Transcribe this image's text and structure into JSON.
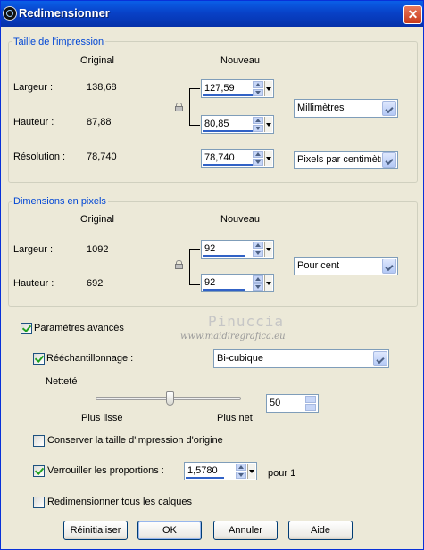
{
  "window": {
    "title": "Redimensionner",
    "close_glyph": "✕",
    "icon": "app-icon"
  },
  "print_size": {
    "legend": "Taille de l'impression",
    "col_original": "Original",
    "col_new": "Nouveau",
    "width_label": "Largeur :",
    "width_original": "138,68",
    "width_new": "127,59",
    "height_label": "Hauteur :",
    "height_original": "87,88",
    "height_new": "80,85",
    "resolution_label": "Résolution :",
    "resolution_original": "78,740",
    "resolution_new": "78,740",
    "unit_select": "Millimètres",
    "resolution_unit_select": "Pixels par centimètre"
  },
  "pixel_dims": {
    "legend": "Dimensions en pixels",
    "col_original": "Original",
    "col_new": "Nouveau",
    "width_label": "Largeur :",
    "width_original": "1092",
    "width_new": "92",
    "height_label": "Hauteur :",
    "height_original": "692",
    "height_new": "92",
    "unit_select": "Pour cent"
  },
  "watermark": {
    "line1": "Pinuccia",
    "line2": "www.maidiregrafica.eu"
  },
  "advanced": {
    "checkbox_label": "Paramètres avancés",
    "checked": true,
    "resample_label": "Rééchantillonnage :",
    "resample_checked": true,
    "resample_method": "Bi-cubique",
    "sharpness_label": "Netteté",
    "slider_left_label": "Plus lisse",
    "slider_right_label": "Plus net",
    "sharpness_value": "50",
    "sharpness_fraction": 0.5,
    "keep_print_size_label": "Conserver la taille d'impression d'origine",
    "keep_print_size_checked": false,
    "lock_ratio_label": "Verrouiller les proportions :",
    "lock_ratio_checked": true,
    "ratio_value": "1,5780",
    "ratio_suffix": "pour 1",
    "resize_all_layers_label": "Redimensionner tous les calques",
    "resize_all_layers_checked": false
  },
  "buttons": {
    "reset": "Réinitialiser",
    "ok": "OK",
    "cancel": "Annuler",
    "help": "Aide"
  }
}
